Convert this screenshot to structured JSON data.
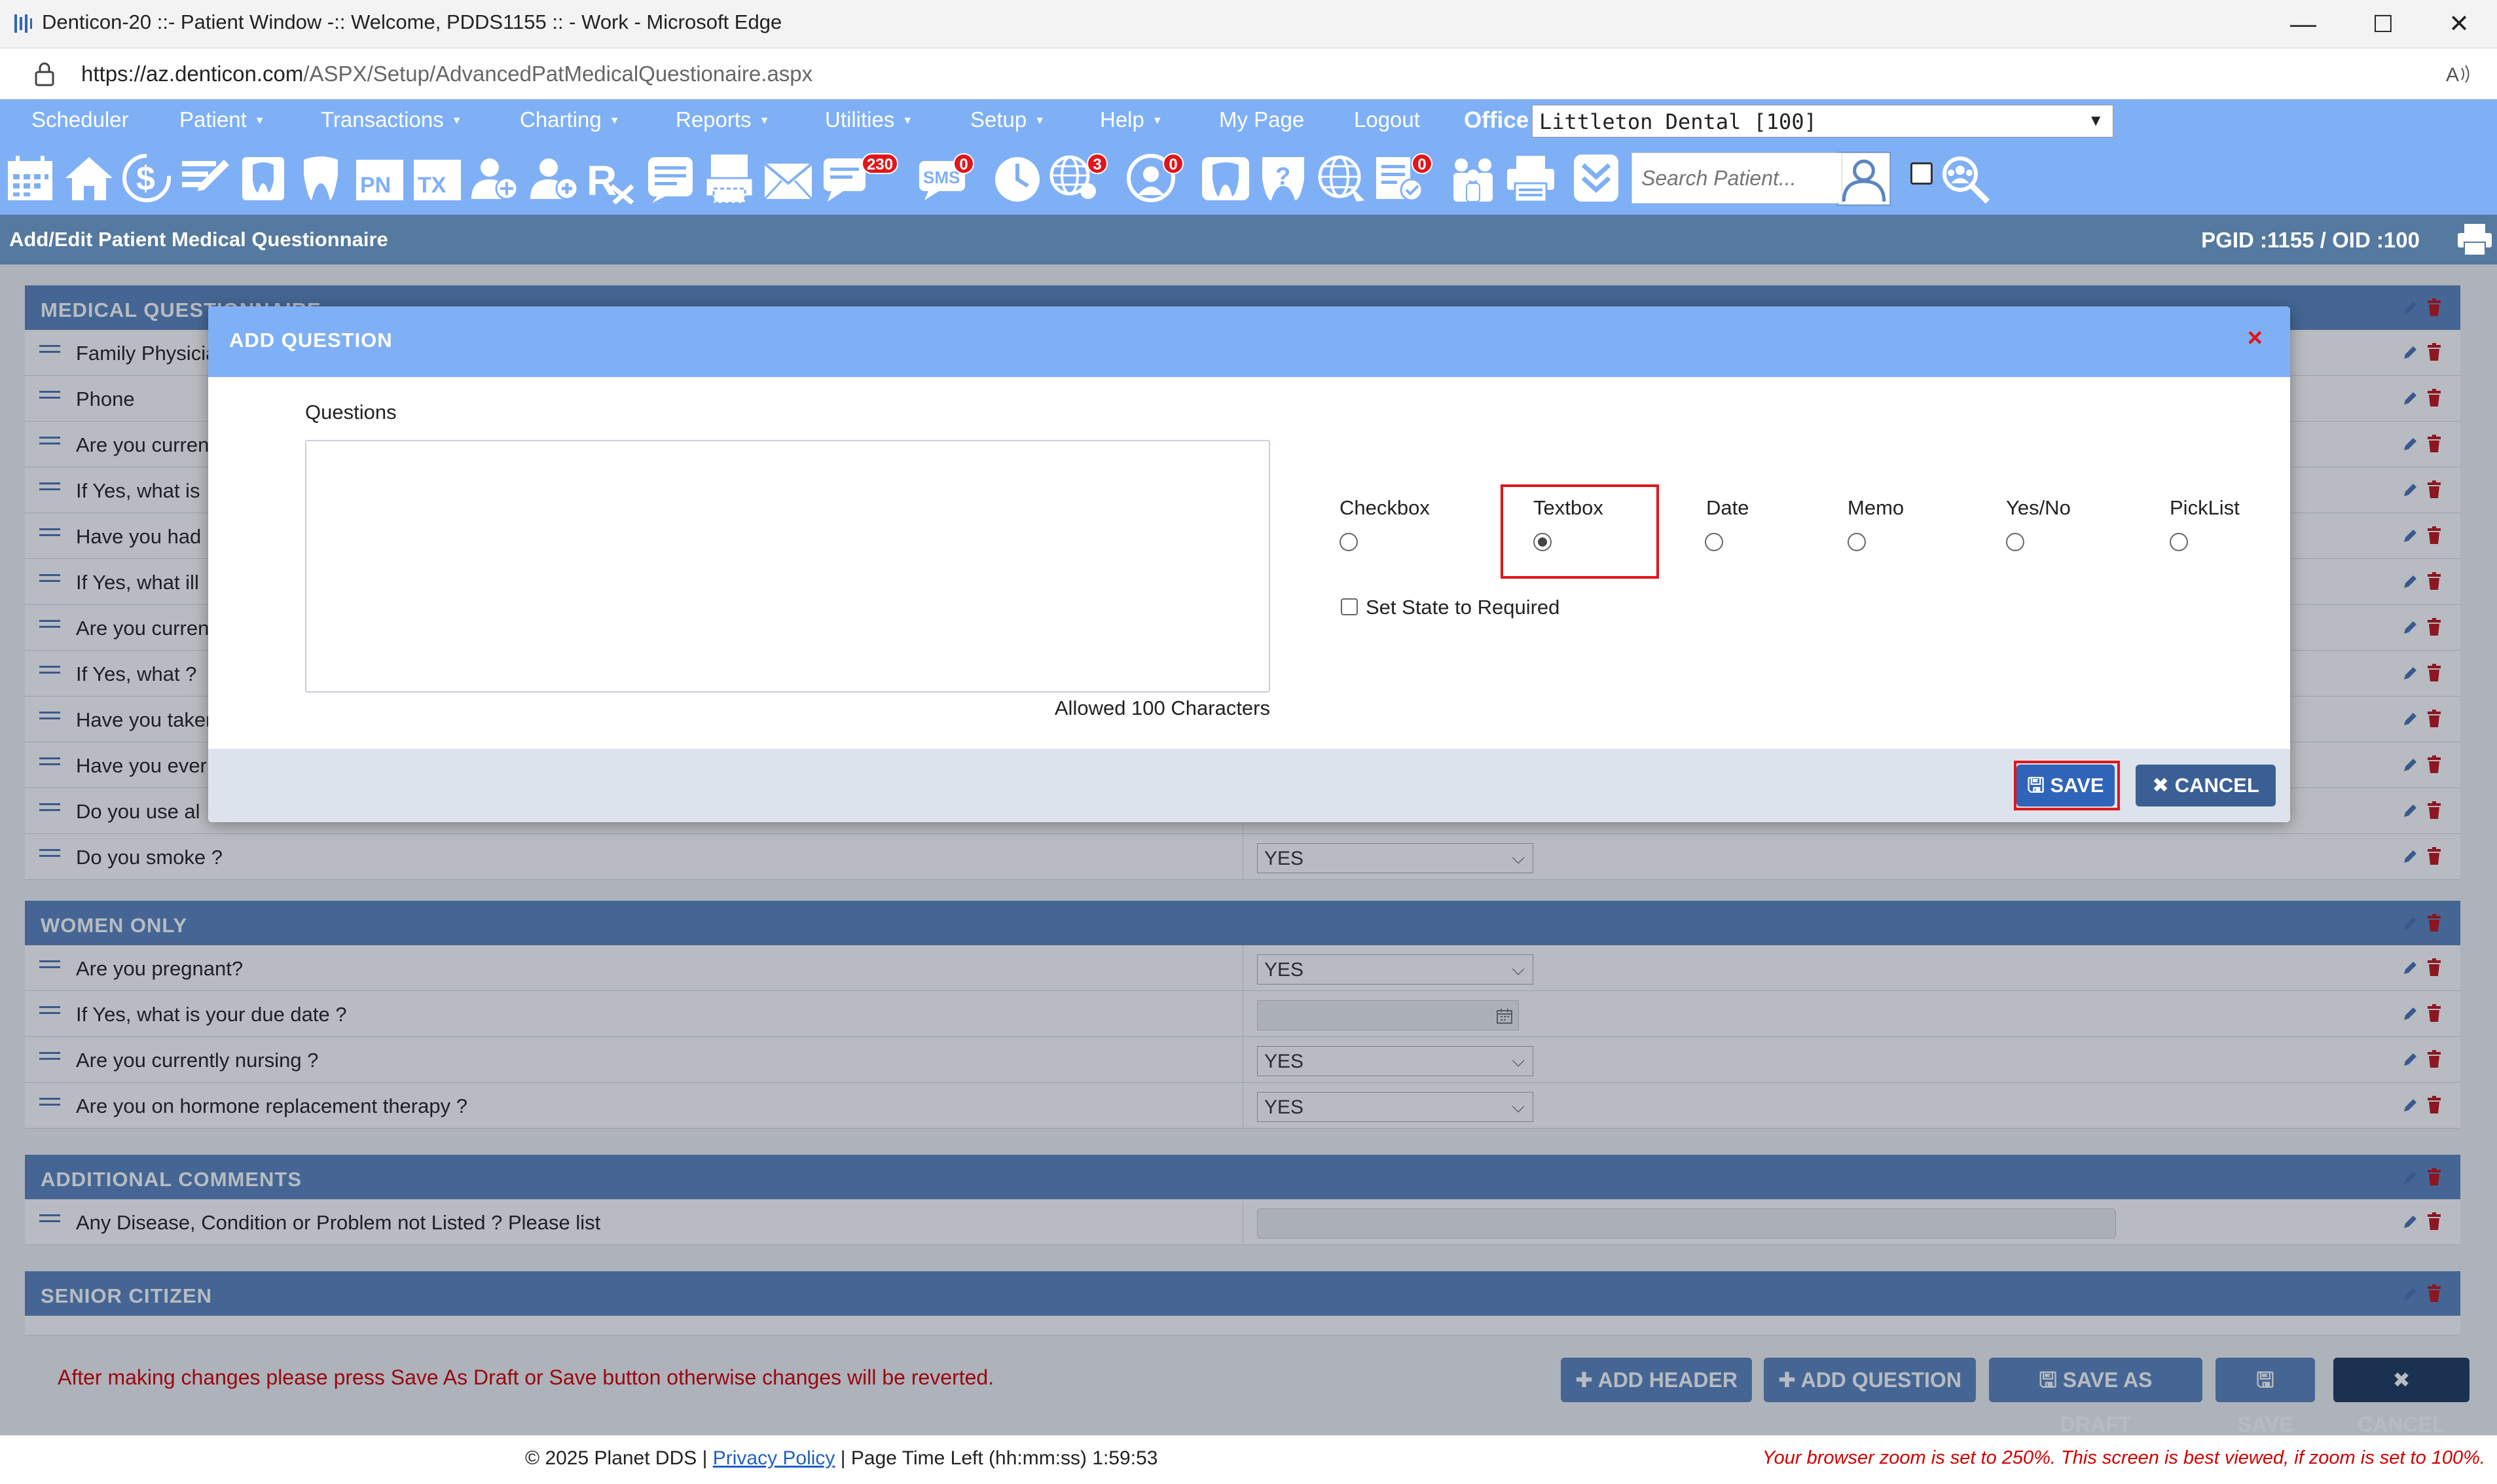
{
  "window": {
    "title": "Denticon-20 ::- Patient Window -:: Welcome, PDDS1155 :: - Work - Microsoft Edge",
    "minimize": "—",
    "maximize": "☐",
    "close": "✕"
  },
  "address": {
    "host": "https://az.denticon.com",
    "path": "/ASPX/Setup/AdvancedPatMedicalQuestionaire.aspx"
  },
  "menu": {
    "items": [
      {
        "label": "Scheduler",
        "caret": ""
      },
      {
        "label": "Patient",
        "caret": "▼"
      },
      {
        "label": "Transactions",
        "caret": "▼"
      },
      {
        "label": "Charting",
        "caret": "▼"
      },
      {
        "label": "Reports",
        "caret": "▼"
      },
      {
        "label": "Utilities",
        "caret": "▼"
      },
      {
        "label": "Setup",
        "caret": "▼"
      },
      {
        "label": "Help",
        "caret": "▼"
      },
      {
        "label": "My Page",
        "caret": ""
      },
      {
        "label": "Logout",
        "caret": ""
      }
    ],
    "office_label": "Office",
    "office_value": "Littleton Dental [100]"
  },
  "toolbar": {
    "badges": {
      "messages": "230",
      "sms": "0",
      "online": "3",
      "support": "0",
      "forms": "0"
    },
    "sms_text": "SMS",
    "pn_text": "PN",
    "tx_text": "TX",
    "search_placeholder": "Search Patient..."
  },
  "page": {
    "title": "Add/Edit Patient Medical Questionnaire",
    "ids": "PGID :1155  /  OID :100"
  },
  "sections": {
    "medical": "MEDICAL QUESTIONNAIRE",
    "women": "WOMEN ONLY",
    "comments": "ADDITIONAL COMMENTS",
    "senior": "SENIOR CITIZEN"
  },
  "medical_rows": [
    "Family Physician",
    "Phone",
    "Are you currently",
    "If Yes, what is",
    "Have you had",
    "If Yes, what ill",
    "Are you currently",
    "If Yes, what ?",
    "Have you taken",
    "Have you ever",
    "Do you use al",
    "Do you smoke ?"
  ],
  "smoke_value": "YES",
  "women_rows": [
    {
      "q": "Are you pregnant?",
      "v": "YES"
    },
    {
      "q": "If Yes, what is your due date ?",
      "v": ""
    },
    {
      "q": "Are you currently nursing ?",
      "v": "YES"
    },
    {
      "q": "Are you on hormone replacement therapy ?",
      "v": "YES"
    }
  ],
  "comments_row": "Any Disease, Condition or Problem not Listed ? Please list",
  "bottom": {
    "warning": "After making changes please press Save As Draft or Save button otherwise changes will be reverted.",
    "add_header": "✚ ADD HEADER",
    "add_question": "✚ ADD QUESTION",
    "save_draft": "🖫 SAVE AS DRAFT",
    "save": "🖫 SAVE",
    "cancel": "✖ CANCEL"
  },
  "footer": {
    "copyright": "© 2025 Planet DDS | ",
    "privacy": "Privacy Policy",
    "time": " |  Page Time Left (hh:mm:ss) 1:59:53",
    "zoom": "Your browser zoom is set to 250%. This screen is best viewed, if zoom is set to 100%."
  },
  "modal": {
    "title": "ADD QUESTION",
    "close": "×",
    "questions_label": "Questions",
    "allowed": "Allowed 100 Characters",
    "options": [
      "Checkbox",
      "Textbox",
      "Date",
      "Memo",
      "Yes/No",
      "PickList"
    ],
    "selected_option": "Textbox",
    "required_label": "Set State to Required",
    "save": "🖫  SAVE",
    "cancel": "✖  CANCEL"
  }
}
